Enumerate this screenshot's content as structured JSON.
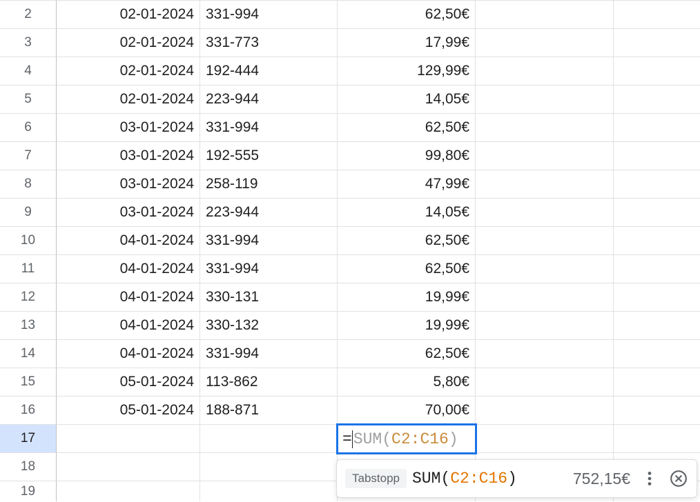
{
  "rows": [
    {
      "num": "2",
      "date": "02-01-2024",
      "code": "331-994",
      "amount": "62,50€"
    },
    {
      "num": "3",
      "date": "02-01-2024",
      "code": "331-773",
      "amount": "17,99€"
    },
    {
      "num": "4",
      "date": "02-01-2024",
      "code": "192-444",
      "amount": "129,99€"
    },
    {
      "num": "5",
      "date": "02-01-2024",
      "code": "223-944",
      "amount": "14,05€"
    },
    {
      "num": "6",
      "date": "03-01-2024",
      "code": "331-994",
      "amount": "62,50€"
    },
    {
      "num": "7",
      "date": "03-01-2024",
      "code": "192-555",
      "amount": "99,80€"
    },
    {
      "num": "8",
      "date": "03-01-2024",
      "code": "258-119",
      "amount": "47,99€"
    },
    {
      "num": "9",
      "date": "03-01-2024",
      "code": "223-944",
      "amount": "14,05€"
    },
    {
      "num": "10",
      "date": "04-01-2024",
      "code": "331-994",
      "amount": "62,50€"
    },
    {
      "num": "11",
      "date": "04-01-2024",
      "code": "331-994",
      "amount": "62,50€"
    },
    {
      "num": "12",
      "date": "04-01-2024",
      "code": "330-131",
      "amount": "19,99€"
    },
    {
      "num": "13",
      "date": "04-01-2024",
      "code": "330-132",
      "amount": "19,99€"
    },
    {
      "num": "14",
      "date": "04-01-2024",
      "code": "331-994",
      "amount": "62,50€"
    },
    {
      "num": "15",
      "date": "05-01-2024",
      "code": "113-862",
      "amount": "5,80€"
    },
    {
      "num": "16",
      "date": "05-01-2024",
      "code": "188-871",
      "amount": "70,00€"
    }
  ],
  "active_row_num": "17",
  "empty_row_num": "18",
  "partial_row_num": "19",
  "formula": {
    "eq": "=",
    "fn": "SUM",
    "open": "(",
    "range": "C2:C16",
    "close": ")"
  },
  "suggestion": {
    "chip": "Tabstopp",
    "fn": "SUM",
    "open": "(",
    "range": "C2:C16",
    "close": ")",
    "result": "752,15€"
  }
}
